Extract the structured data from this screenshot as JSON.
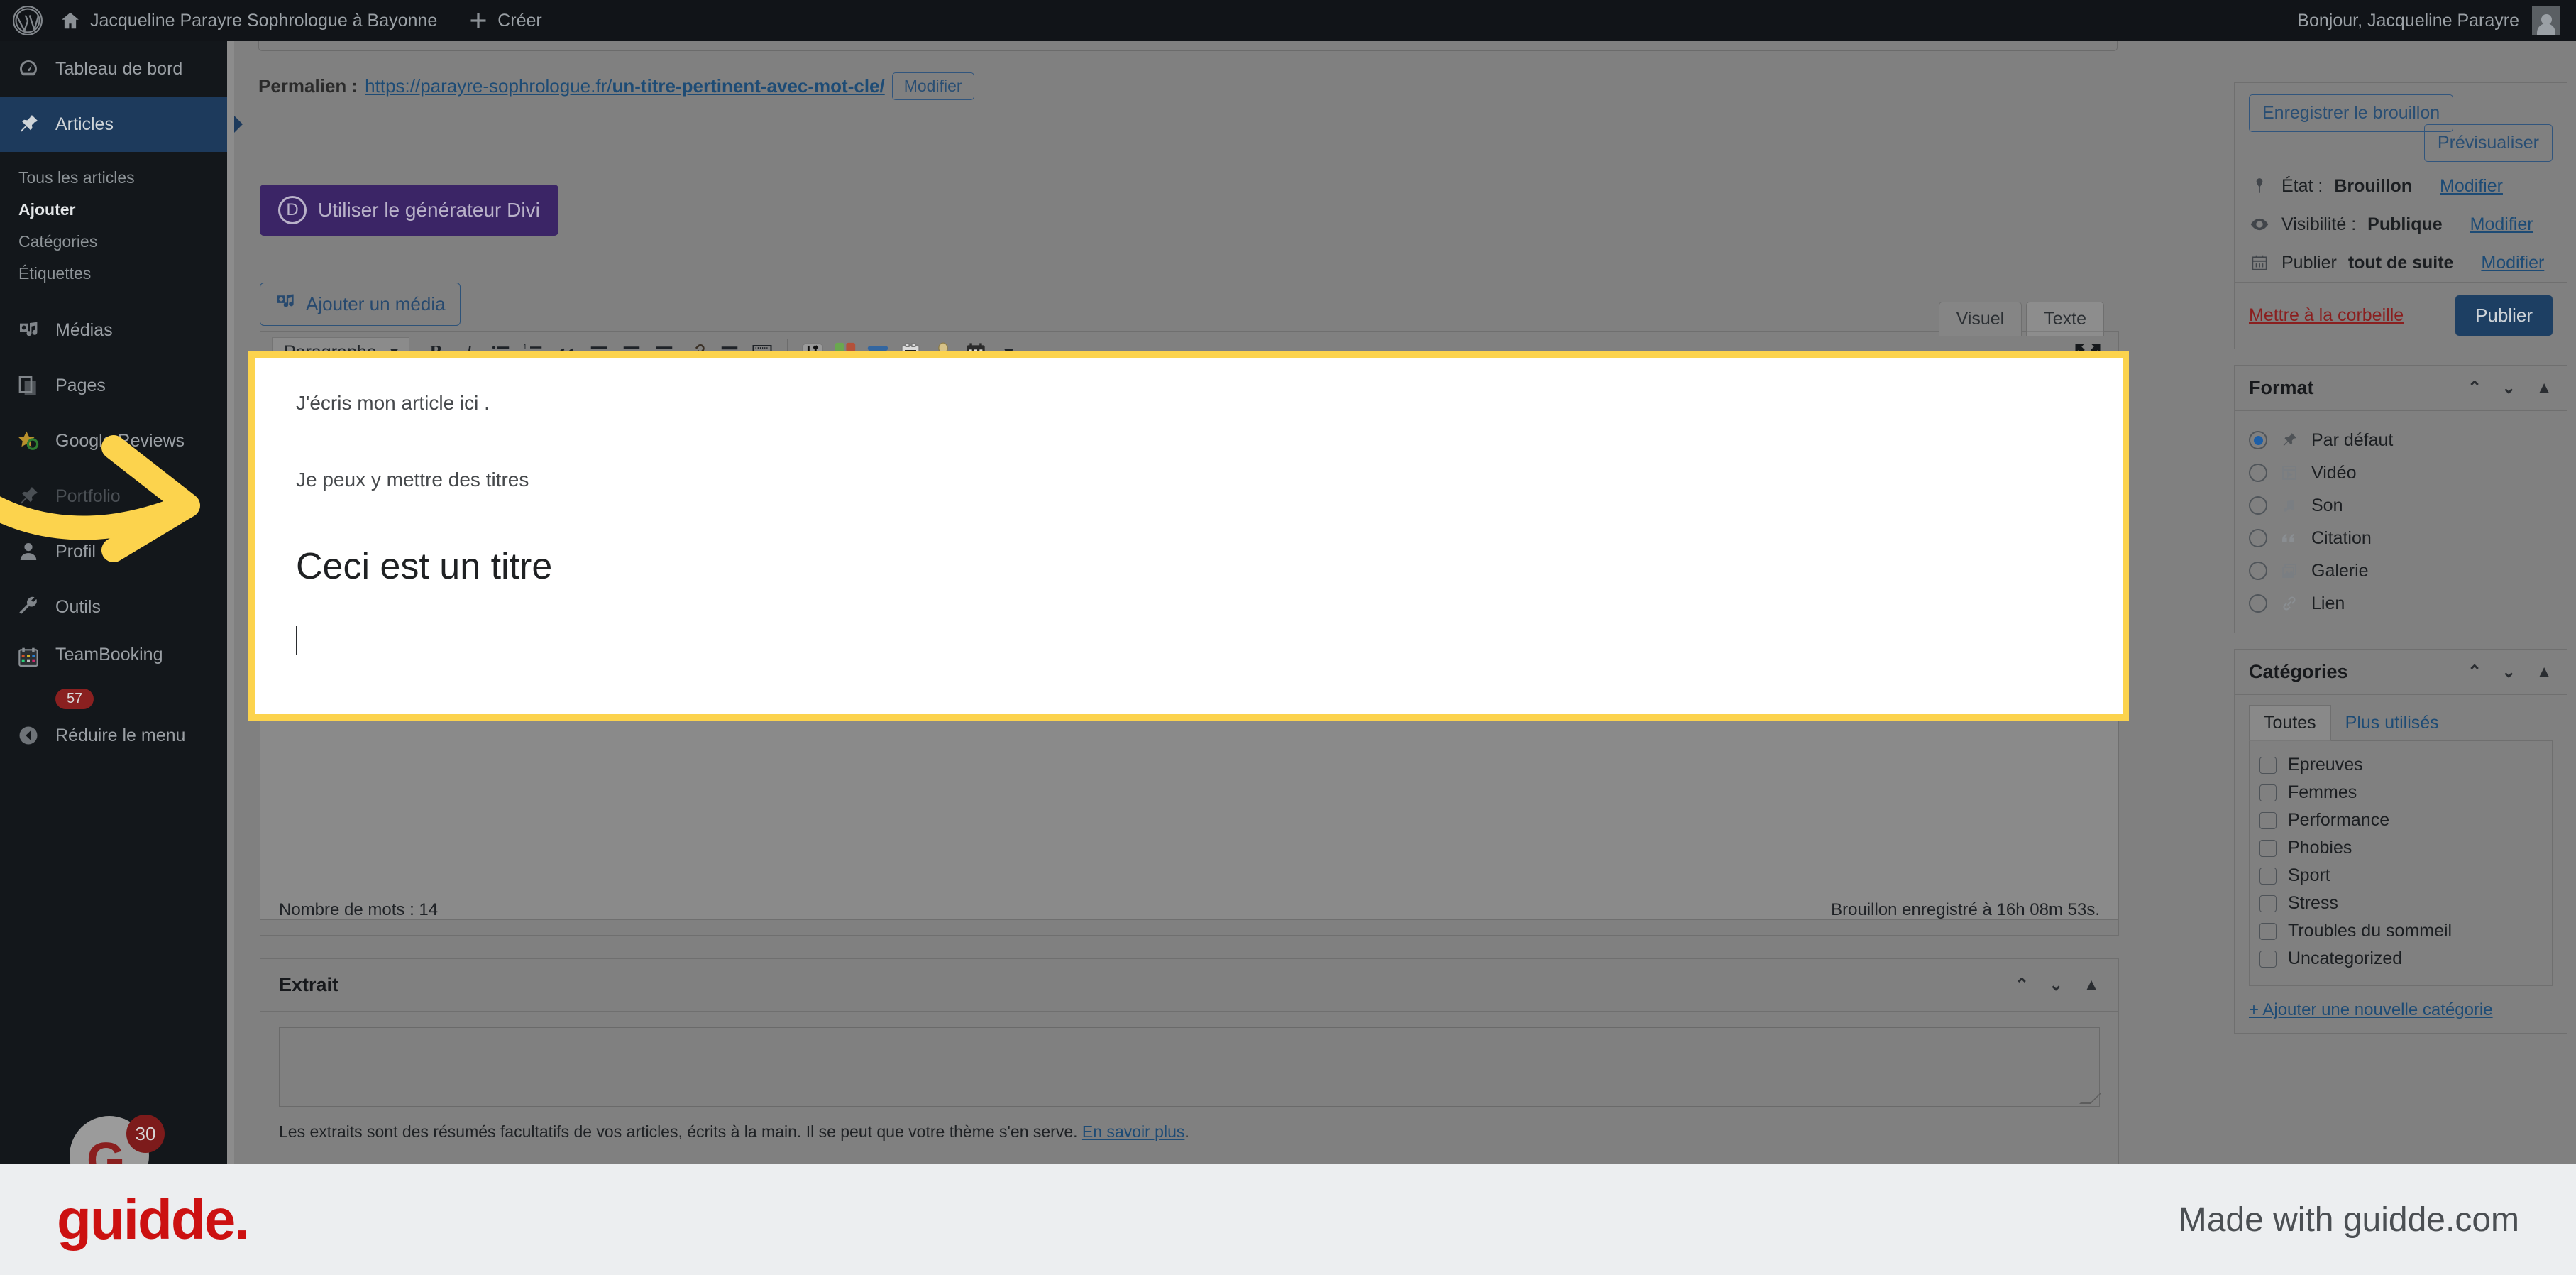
{
  "adminbar": {
    "site_title": "Jacqueline Parayre Sophrologue à Bayonne",
    "create_label": "Créer",
    "greeting": "Bonjour, Jacqueline Parayre",
    "wp_logo_name": "wordpress-logo-icon",
    "home_icon_name": "home-icon",
    "plus_icon_name": "plus-icon",
    "avatar_name": "user-avatar"
  },
  "adminmenu": {
    "items": [
      {
        "label": "Tableau de bord",
        "icon": "dashboard-icon"
      },
      {
        "label": "Articles",
        "icon": "pin-icon",
        "current": true
      },
      {
        "label": "Médias",
        "icon": "media-icon"
      },
      {
        "label": "Pages",
        "icon": "pages-icon"
      },
      {
        "label": "Google Reviews",
        "icon": "star-icon"
      },
      {
        "label": "Portfolio",
        "icon": "pin-icon"
      },
      {
        "label": "Profil",
        "icon": "user-icon"
      },
      {
        "label": "Outils",
        "icon": "wrench-icon"
      },
      {
        "label": "TeamBooking",
        "icon": "calendar-icon",
        "badge": "57"
      }
    ],
    "submenu": [
      {
        "label": "Tous les articles"
      },
      {
        "label": "Ajouter",
        "current": true
      },
      {
        "label": "Catégories"
      },
      {
        "label": "Étiquettes"
      }
    ],
    "collapse_label": "Réduire le menu",
    "collapse_icon": "collapse-arrow-icon"
  },
  "permalink": {
    "label": "Permalien :",
    "base": "https://parayre-sophrologue.fr/",
    "slug": "un-titre-pertinent-avec-mot-cle/",
    "edit_label": "Modifier"
  },
  "buttons": {
    "divi": "Utiliser le générateur Divi",
    "divi_mark": "D",
    "add_media": "Ajouter un média"
  },
  "editor": {
    "tabs": [
      {
        "label": "Visuel",
        "active": true
      },
      {
        "label": "Texte",
        "active": false
      }
    ],
    "format_select": "Paragraphe",
    "toolbar_icons": [
      "bold-icon",
      "italic-icon",
      "bulleted-list-icon",
      "numbered-list-icon",
      "blockquote-icon",
      "align-left-icon",
      "align-center-icon",
      "align-right-icon",
      "link-icon",
      "read-more-icon",
      "keyboard-shortcuts-icon",
      "toolbar-toggle-icon",
      "color-palette-icon",
      "divi-layout-icon",
      "shortcode-icon",
      "team-member-icon",
      "booking-calendar-icon",
      "dropdown-caret-icon"
    ],
    "fullscreen_icon": "fullscreen-icon",
    "content": {
      "paragraph_1": "J'écris mon article ici .",
      "paragraph_2": "Je peux y mettre des titres",
      "heading_1": "Ceci est un titre"
    },
    "word_count_label": "Nombre de mots : 14",
    "draft_saved_label": "Brouillon enregistré à 16h 08m 53s."
  },
  "excerpt": {
    "title": "Extrait",
    "value": "",
    "help_text": "Les extraits sont des résumés facultatifs de vos articles, écrits à la main. Il se peut que votre thème s'en serve.",
    "help_link": "En savoir plus",
    "help_link_suffix": ".",
    "handles": {
      "up": "⌃",
      "down": "⌄",
      "toggle": "▲"
    }
  },
  "publish_box": {
    "save_draft": "Enregistrer le brouillon",
    "preview": "Prévisualiser",
    "rows": [
      {
        "icon": "pin-status-icon",
        "prefix": "État : ",
        "value": "Brouillon",
        "link": "Modifier"
      },
      {
        "icon": "eye-icon",
        "prefix": "Visibilité : ",
        "value": "Publique",
        "link": "Modifier"
      },
      {
        "icon": "calendar-icon",
        "prefix": "Publier ",
        "value": "tout de suite",
        "link": "Modifier"
      }
    ],
    "trash": "Mettre à la corbeille",
    "publish": "Publier"
  },
  "format_box": {
    "title": "Format",
    "handles": {
      "up": "⌃",
      "down": "⌄",
      "toggle": "▲"
    },
    "options": [
      {
        "label": "Par défaut",
        "icon": "pin-icon",
        "selected": true
      },
      {
        "label": "Vidéo",
        "icon": "video-icon",
        "selected": false
      },
      {
        "label": "Son",
        "icon": "audio-icon",
        "selected": false
      },
      {
        "label": "Citation",
        "icon": "quote-icon",
        "selected": false
      },
      {
        "label": "Galerie",
        "icon": "gallery-icon",
        "selected": false
      },
      {
        "label": "Lien",
        "icon": "link-icon",
        "selected": false
      }
    ]
  },
  "categories_box": {
    "title": "Catégories",
    "handles": {
      "up": "⌃",
      "down": "⌄",
      "toggle": "▲"
    },
    "tabs": [
      {
        "label": "Toutes",
        "active": true
      },
      {
        "label": "Plus utilisés",
        "active": false
      }
    ],
    "items": [
      {
        "label": "Epreuves",
        "checked": false
      },
      {
        "label": "Femmes",
        "checked": false
      },
      {
        "label": "Performance",
        "checked": false
      },
      {
        "label": "Phobies",
        "checked": false
      },
      {
        "label": "Sport",
        "checked": false
      },
      {
        "label": "Stress",
        "checked": false
      },
      {
        "label": "Troubles du sommeil",
        "checked": false
      },
      {
        "label": "Uncategorized",
        "checked": false
      }
    ],
    "add_link": "+ Ajouter une nouvelle catégorie"
  },
  "floating": {
    "badge_count": "30",
    "avatar_glyph": "G"
  },
  "footer": {
    "logo": "guidde.",
    "made_with": "Made with guidde.com"
  },
  "colors": {
    "spotlight_border": "#fcd34d",
    "divi_purple": "#3b2566",
    "publish_blue": "#1d3f63",
    "menu_current": "#1d3a5c",
    "guidde_red": "#cc1111",
    "trash_red": "#8a1f1f",
    "badge_red": "#8a2020"
  }
}
